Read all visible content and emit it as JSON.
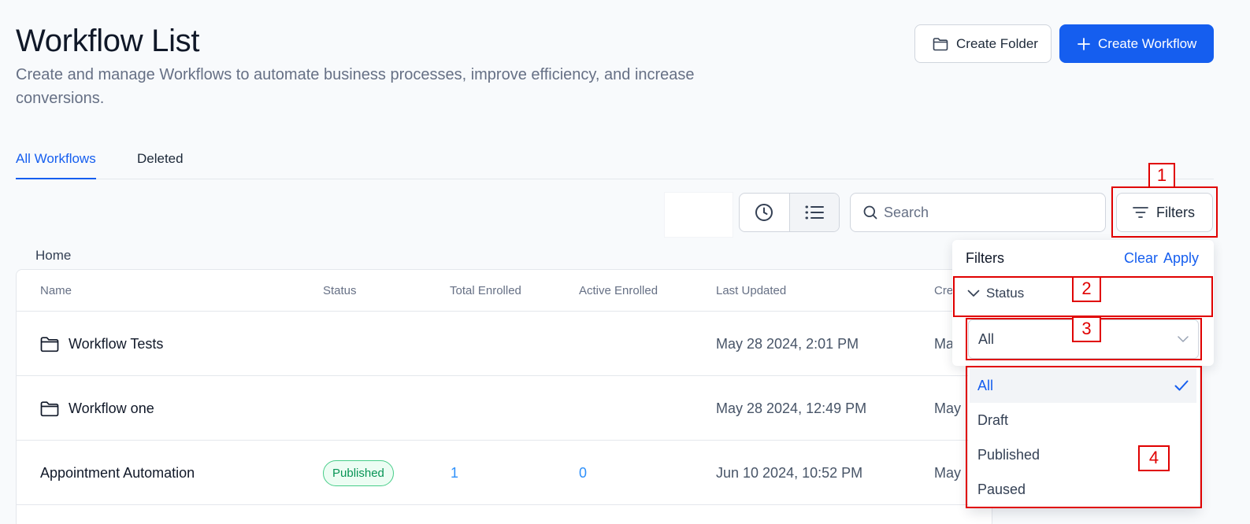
{
  "header": {
    "title": "Workflow List",
    "subtitle": "Create and manage Workflows to automate business processes, improve efficiency, and increase conversions.",
    "create_folder_label": "Create Folder",
    "create_workflow_label": "Create Workflow"
  },
  "tabs": [
    {
      "label": "All Workflows",
      "active": true
    },
    {
      "label": "Deleted",
      "active": false
    }
  ],
  "toolbar": {
    "search_placeholder": "Search",
    "filters_label": "Filters"
  },
  "breadcrumb": "Home",
  "table": {
    "columns": [
      "Name",
      "Status",
      "Total Enrolled",
      "Active Enrolled",
      "Last Updated",
      "Cre"
    ],
    "rows": [
      {
        "type": "folder",
        "name": "Workflow Tests",
        "status": "",
        "total": "",
        "active": "",
        "updated": "May 28 2024, 2:01 PM",
        "created": "Ma"
      },
      {
        "type": "folder",
        "name": "Workflow one",
        "status": "",
        "total": "",
        "active": "",
        "updated": "May 28 2024, 12:49 PM",
        "created": "May"
      },
      {
        "type": "workflow",
        "name": "Appointment Automation",
        "status": "Published",
        "total": "1",
        "active": "0",
        "updated": "Jun 10 2024, 10:52 PM",
        "created": "May"
      }
    ]
  },
  "filter_panel": {
    "title": "Filters",
    "clear_label": "Clear",
    "apply_label": "Apply",
    "status_label": "Status",
    "selected_value": "All",
    "options": [
      "All",
      "Draft",
      "Published",
      "Paused"
    ]
  },
  "annotations": [
    "1",
    "2",
    "3",
    "4"
  ],
  "colors": {
    "primary": "#155eef",
    "annotation": "#e00000",
    "published_text": "#079455",
    "link_number": "#2e90fa"
  },
  "icons": {
    "create_folder": "folder-icon",
    "create_workflow": "plus-icon",
    "view_recent": "clock-icon",
    "view_list": "list-icon",
    "search": "search-icon",
    "filters": "filter-lines-icon",
    "status_toggle": "chevron-down-icon",
    "select": "chevron-down-icon",
    "selected_option": "check-icon",
    "folder_row": "folder-icon"
  }
}
